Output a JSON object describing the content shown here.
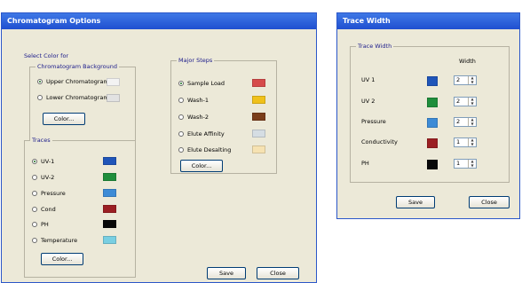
{
  "chromatogram_options": {
    "title": "Chromatogram Options",
    "select_color_label": "Select Color for",
    "background_group": {
      "title": "Chromatogram Background",
      "options": [
        {
          "label": "Upper Chromatogram",
          "selected": true,
          "color": "#f3f3f3"
        },
        {
          "label": "Lower Chromatogram",
          "selected": false,
          "color": "#e2e2e2"
        }
      ],
      "color_button": "Color..."
    },
    "traces_group": {
      "title": "Traces",
      "options": [
        {
          "label": "UV-1",
          "selected": true,
          "color": "#1f55b9"
        },
        {
          "label": "UV-2",
          "selected": false,
          "color": "#1f8e3c"
        },
        {
          "label": "Pressure",
          "selected": false,
          "color": "#3d8bd6"
        },
        {
          "label": "Cond",
          "selected": false,
          "color": "#9b1f23"
        },
        {
          "label": "PH",
          "selected": false,
          "color": "#080808"
        },
        {
          "label": "Temperature",
          "selected": false,
          "color": "#79cfe2"
        }
      ],
      "color_button": "Color..."
    },
    "major_steps_group": {
      "title": "Major Steps",
      "options": [
        {
          "label": "Sample Load",
          "selected": true,
          "color": "#d64b4b"
        },
        {
          "label": "Wash-1",
          "selected": false,
          "color": "#f0c11b"
        },
        {
          "label": "Wash-2",
          "selected": false,
          "color": "#7a3d1a"
        },
        {
          "label": "Elute Affinity",
          "selected": false,
          "color": "#d5dde3"
        },
        {
          "label": "Elute Desalting",
          "selected": false,
          "color": "#f6e2b2"
        }
      ],
      "color_button": "Color..."
    },
    "save_button": "Save",
    "close_button": "Close"
  },
  "trace_width": {
    "title": "Trace Width",
    "group_title": "Trace Width",
    "width_header": "Width",
    "rows": [
      {
        "label": "UV 1",
        "color": "#1f55b9",
        "value": "2"
      },
      {
        "label": "UV 2",
        "color": "#1f8e3c",
        "value": "2"
      },
      {
        "label": "Pressure",
        "color": "#3d8bd6",
        "value": "2"
      },
      {
        "label": "Conductivity",
        "color": "#9b1f23",
        "value": "1"
      },
      {
        "label": "PH",
        "color": "#080808",
        "value": "1"
      }
    ],
    "save_button": "Save",
    "close_button": "Close"
  }
}
